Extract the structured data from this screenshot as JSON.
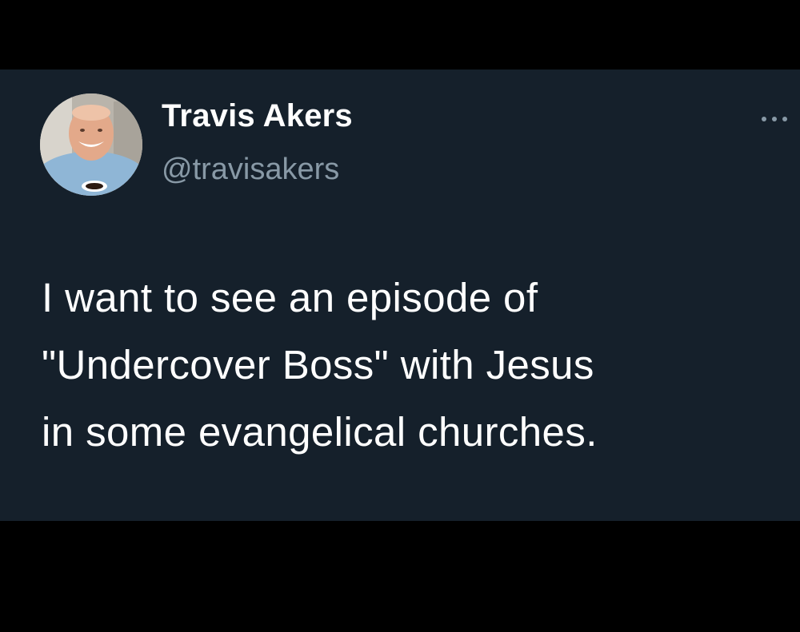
{
  "tweet": {
    "author": {
      "name": "Travis Akers",
      "handle": "@travisakers",
      "avatar_icon": "user-avatar-photo"
    },
    "more_icon": "more-options-icon",
    "text_lines": [
      "I want to see an episode of",
      "\"Undercover Boss\" with Jesus",
      "in some evangelical churches."
    ]
  },
  "colors": {
    "page_background": "#000000",
    "card_background": "#15202b",
    "text_primary": "#ffffff",
    "text_secondary": "#8899a6"
  }
}
